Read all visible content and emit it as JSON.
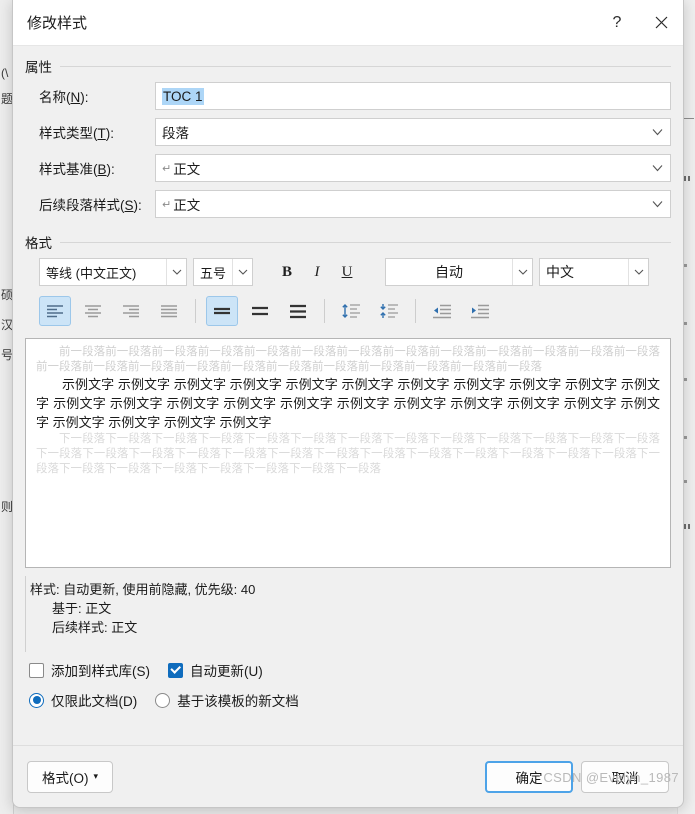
{
  "dialog": {
    "title": "修改样式",
    "help_icon": "question-mark-icon",
    "close_icon": "close-icon"
  },
  "properties": {
    "group_label": "属性",
    "name": {
      "label_prefix": "名称(",
      "accel": "N",
      "label_suffix": "):",
      "value": "TOC 1"
    },
    "style_type": {
      "label_prefix": "样式类型(",
      "accel": "T",
      "label_suffix": "):",
      "value": "段落"
    },
    "style_based_on": {
      "label_prefix": "样式基准(",
      "accel": "B",
      "label_suffix": "):",
      "pilcrow": "↵",
      "value": "正文"
    },
    "next_paragraph_style": {
      "label_prefix": "后续段落样式(",
      "accel": "S",
      "label_suffix": "):",
      "pilcrow": "↵",
      "value": "正文"
    }
  },
  "format": {
    "group_label": "格式",
    "font_name": "等线 (中文正文)",
    "font_size": "五号",
    "bold_label": "B",
    "italic_label": "I",
    "underline_label": "U",
    "font_color": "自动",
    "language": "中文",
    "align_buttons": [
      {
        "name": "align-left-button",
        "selected": true
      },
      {
        "name": "align-center-button",
        "selected": false
      },
      {
        "name": "align-right-button",
        "selected": false
      },
      {
        "name": "align-justify-button",
        "selected": false
      }
    ],
    "line_spacing_buttons": [
      {
        "name": "line-spacing-single-button",
        "selected": true
      },
      {
        "name": "line-spacing-1-5-button",
        "selected": false
      },
      {
        "name": "line-spacing-double-button",
        "selected": false
      }
    ],
    "spacing_buttons": [
      {
        "name": "increase-paragraph-spacing-button",
        "selected": false
      },
      {
        "name": "decrease-paragraph-spacing-button",
        "selected": false
      }
    ],
    "indent_buttons": [
      {
        "name": "decrease-indent-button",
        "selected": false
      },
      {
        "name": "increase-indent-button",
        "selected": false
      }
    ]
  },
  "preview": {
    "previous_paragraph": "前一段落前一段落前一段落前一段落前一段落前一段落前一段落前一段落前一段落前一段落前一段落前一段落前一段落前一段落前一段落前一段落前一段落前一段落前一段落前一段落前一段落前一段落前一段落前一段落",
    "sample_text": "示例文字 示例文字 示例文字 示例文字 示例文字 示例文字 示例文字 示例文字 示例文字 示例文字 示例文字 示例文字 示例文字 示例文字 示例文字 示例文字 示例文字 示例文字 示例文字 示例文字 示例文字 示例文字 示例文字 示例文字 示例文字 示例文字",
    "next_paragraph": "下一段落下一段落下一段落下一段落下一段落下一段落下一段落下一段落下一段落下一段落下一段落下一段落下一段落下一段落下一段落下一段落下一段落下一段落下一段落下一段落下一段落下一段落下一段落下一段落下一段落下一段落下一段落下一段落下一段落下一段落下一段落下一段落下一段落下一段落"
  },
  "description": {
    "line1": "样式: 自动更新, 使用前隐藏, 优先级: 40",
    "line2": "基于: 正文",
    "line3": "后续样式: 正文"
  },
  "options": {
    "add_to_gallery": {
      "label": "添加到样式库(S)",
      "checked": false
    },
    "auto_update": {
      "label": "自动更新(U)",
      "checked": true
    },
    "only_this_document": {
      "label": "仅限此文档(D)",
      "selected": true
    },
    "new_documents_based_on_template": {
      "label": "基于该模板的新文档",
      "selected": false
    }
  },
  "footer": {
    "format_button": "格式(O)",
    "format_caret": "▾",
    "ok_button": "确定",
    "cancel_button": "取消"
  },
  "watermark": "CSDN @Evelyn_1987",
  "background": {
    "left_fragments": [
      "(\\",
      "题",
      "硕",
      "汉",
      "号",
      "则"
    ]
  },
  "colors": {
    "selection_highlight": "#add6f7",
    "accent": "#0f6cbd",
    "toggle_on_bg": "#cce4f7",
    "default_button_border": "#4da3e8"
  }
}
